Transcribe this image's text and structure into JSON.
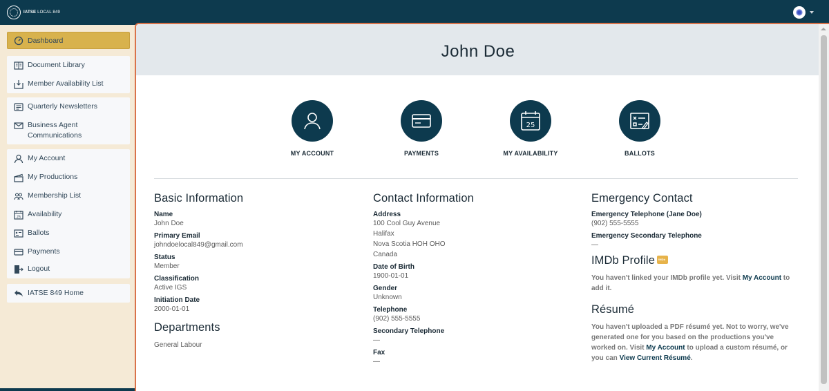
{
  "brand": {
    "name": "IATSE",
    "suffix": "LOCAL 849"
  },
  "sidebar": {
    "dashboard": "Dashboard",
    "group1": [
      {
        "label": "Document Library",
        "icon": "document-library-icon"
      },
      {
        "label": "Member Availability List",
        "icon": "download-icon"
      }
    ],
    "group2": [
      {
        "label": "Quarterly Newsletters",
        "icon": "newsletter-icon"
      },
      {
        "label": "Business Agent Communications",
        "icon": "mail-icon"
      }
    ],
    "group3": [
      {
        "label": "My Account",
        "icon": "user-icon"
      },
      {
        "label": "My Productions",
        "icon": "productions-icon"
      },
      {
        "label": "Membership List",
        "icon": "group-icon"
      },
      {
        "label": "Availability",
        "icon": "calendar-icon"
      },
      {
        "label": "Ballots",
        "icon": "ballot-icon"
      },
      {
        "label": "Payments",
        "icon": "card-icon"
      }
    ],
    "logout": "Logout",
    "home": "IATSE 849 Home"
  },
  "page": {
    "title": "John Doe"
  },
  "tiles": [
    {
      "label": "MY ACCOUNT",
      "icon": "user-icon"
    },
    {
      "label": "PAYMENTS",
      "icon": "card-icon"
    },
    {
      "label": "MY AVAILABILITY",
      "icon": "calendar-icon",
      "day": "25"
    },
    {
      "label": "BALLOTS",
      "icon": "ballot-icon"
    }
  ],
  "basic": {
    "heading": "Basic Information",
    "name_label": "Name",
    "name": "John Doe",
    "email_label": "Primary Email",
    "email": "johndoelocal849@gmail.com",
    "status_label": "Status",
    "status": "Member",
    "class_label": "Classification",
    "classification": "Active IGS",
    "init_label": "Initiation Date",
    "initiation": "2000-01-01",
    "dept_heading": "Departments",
    "department": "General Labour"
  },
  "contact": {
    "heading": "Contact Information",
    "address_label": "Address",
    "address": [
      "100 Cool Guy Avenue",
      "Halifax",
      "Nova Scotia HOH OHO",
      "Canada"
    ],
    "dob_label": "Date of Birth",
    "dob": "1900-01-01",
    "gender_label": "Gender",
    "gender": "Unknown",
    "tel_label": "Telephone",
    "tel": "(902) 555-5555",
    "tel2_label": "Secondary Telephone",
    "tel2": "—",
    "fax_label": "Fax",
    "fax": "—"
  },
  "emergency": {
    "heading": "Emergency Contact",
    "tel_label": "Emergency Telephone (Jane Doe)",
    "tel": "(902) 555-5555",
    "tel2_label": "Emergency Secondary Telephone",
    "tel2": "—",
    "imdb_heading": "IMDb Profile",
    "imdb_text_a": "You haven't linked your IMDb profile yet. Visit ",
    "imdb_link": "My Account",
    "imdb_text_b": " to add it.",
    "resume_heading": "Résumé",
    "resume_text_a": "You haven't uploaded a PDF résumé yet. Not to worry, we've generated one for you based on the productions you've worked on. Visit ",
    "resume_link1": "My Account",
    "resume_text_b": " to upload a custom résumé, or you can ",
    "resume_link2": "View Current Résumé",
    "resume_text_c": "."
  },
  "colors": {
    "navy": "#0d3a4e",
    "gold": "#d8b24d",
    "accent": "#d9734a",
    "cream": "#f5ead6"
  }
}
